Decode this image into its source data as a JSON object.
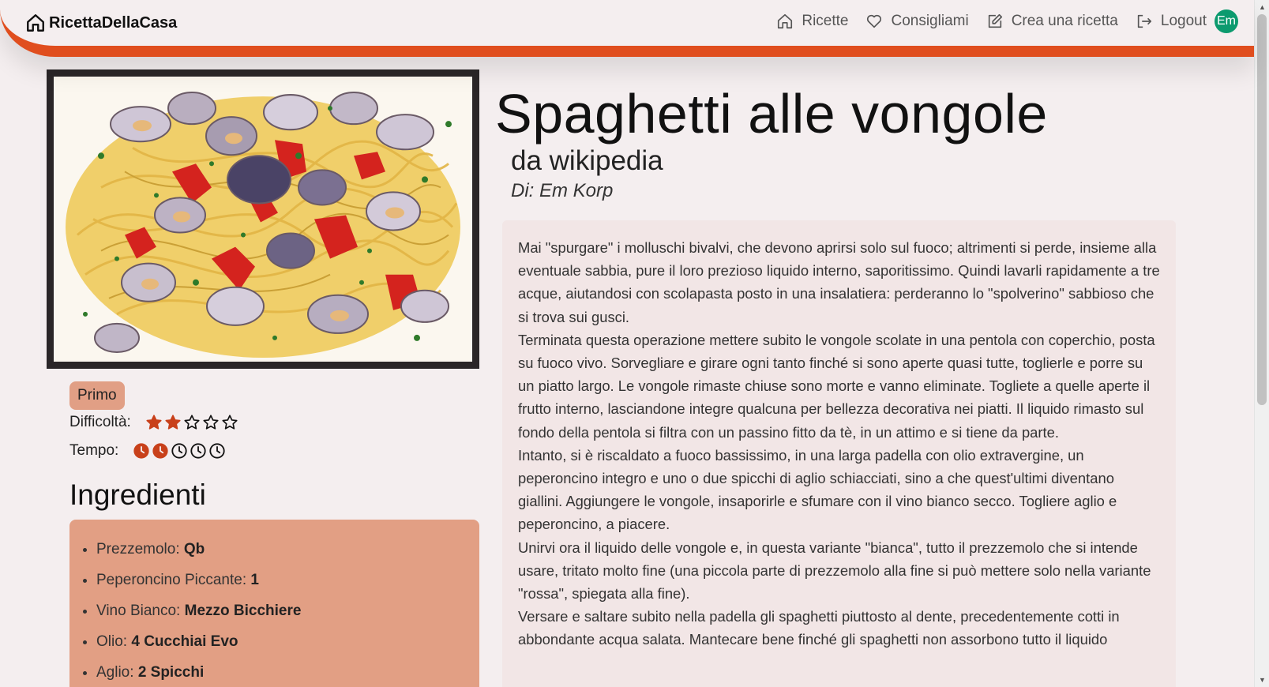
{
  "navbar": {
    "brand": "RicettaDellaCasa",
    "links": [
      {
        "label": "Ricette",
        "icon": "home-icon"
      },
      {
        "label": "Consigliami",
        "icon": "heart-icon"
      },
      {
        "label": "Crea una ricetta",
        "icon": "edit-icon"
      },
      {
        "label": "Logout",
        "icon": "logout-icon"
      }
    ],
    "avatar_initials": "Em",
    "accent_color": "#e04e1e",
    "avatar_color": "#0c9a6e"
  },
  "recipe": {
    "title": "Spaghetti alle vongole",
    "source": "da wikipedia",
    "author": "Di: Em Korp",
    "category": "Primo",
    "difficulty_label": "Difficoltà:",
    "difficulty_level": 2,
    "difficulty_max": 5,
    "time_label": "Tempo:",
    "time_level": 2,
    "time_max": 5,
    "ingredients_title": "Ingredienti",
    "ingredients": [
      {
        "name": "Prezzemolo: ",
        "amount": "Qb"
      },
      {
        "name": "Peperoncino Piccante: ",
        "amount": "1"
      },
      {
        "name": "Vino Bianco: ",
        "amount": "Mezzo Bicchiere"
      },
      {
        "name": "Olio: ",
        "amount": "4 Cucchiai Evo"
      },
      {
        "name": "Aglio: ",
        "amount": "2 Spicchi"
      }
    ],
    "description": [
      "Mai \"spurgare\" i molluschi bivalvi, che devono aprirsi solo sul fuoco; altrimenti si perde, insieme alla eventuale sabbia, pure il loro prezioso liquido interno, saporitissimo. Quindi lavarli rapidamente a tre acque, aiutandosi con scolapasta posto in una insalatiera: perderanno lo \"spolverino\" sabbioso che si trova sui gusci.",
      "Terminata questa operazione mettere subito le vongole scolate in una pentola con coperchio, posta su fuoco vivo. Sorvegliare e girare ogni tanto finché si sono aperte quasi tutte, toglierle e porre su un piatto largo. Le vongole rimaste chiuse sono morte e vanno eliminate. Togliete a quelle aperte il frutto interno, lasciandone integre qualcuna per bellezza decorativa nei piatti. Il liquido rimasto sul fondo della pentola si filtra con un passino fitto da tè, in un attimo e si tiene da parte.",
      "Intanto, si è riscaldato a fuoco bassissimo, in una larga padella con olio extravergine, un peperoncino integro e uno o due spicchi di aglio schiacciati, sino a che quest'ultimi diventano giallini. Aggiungere le vongole, insaporirle e sfumare con il vino bianco secco. Togliere aglio e peperoncino, a piacere.",
      "Unirvi ora il liquido delle vongole e, in questa variante \"bianca\", tutto il prezzemolo che si intende usare, tritato molto fine (una piccola parte di prezzemolo alla fine si può mettere solo nella variante \"rossa\", spiegata alla fine).",
      "Versare e saltare subito nella padella gli spaghetti piuttosto al dente, precedentemente cotti in abbondante acqua salata. Mantecare bene finché gli spaghetti non assorbono tutto il liquido"
    ],
    "star_color": "#c8401a",
    "badge_color": "#e19f85",
    "ingredients_bg": "#e29f84"
  }
}
